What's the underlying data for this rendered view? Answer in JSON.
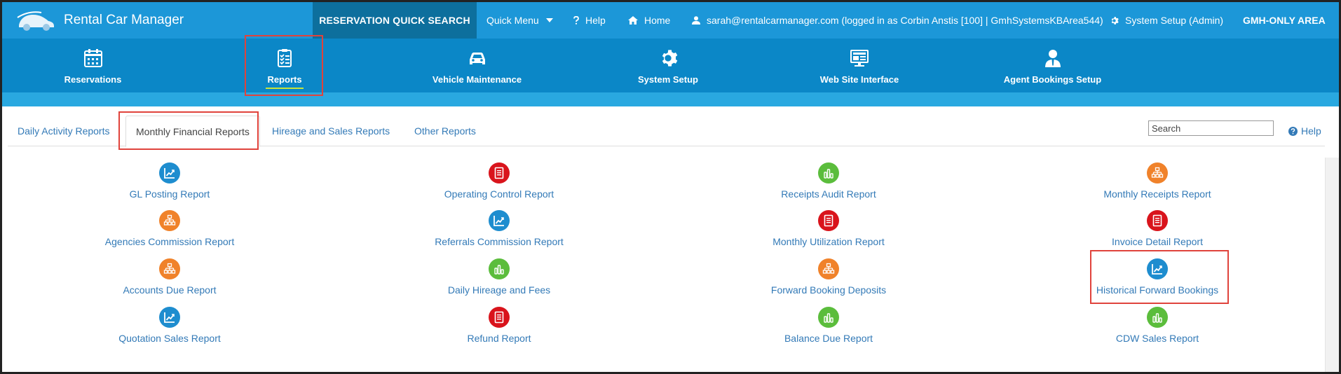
{
  "header": {
    "brand": "Rental Car Manager",
    "quick_search": "RESERVATION QUICK SEARCH",
    "quick_menu": "Quick Menu",
    "help": "Help",
    "home": "Home",
    "user": "sarah@rentalcarmanager.com (logged in as Corbin Anstis [100] | GmhSystemsKBArea544)",
    "system_setup": "System Setup (Admin)",
    "gmh_area": "GMH-ONLY AREA"
  },
  "main_nav": {
    "reservations": "Reservations",
    "reports": "Reports",
    "vehicle_maintenance": "Vehicle Maintenance",
    "system_setup": "System Setup",
    "web_site_interface": "Web Site Interface",
    "agent_bookings_setup": "Agent Bookings Setup",
    "active": "Reports"
  },
  "tabs": {
    "daily": "Daily Activity Reports",
    "monthly": "Monthly Financial Reports",
    "hireage": "Hireage and Sales Reports",
    "other": "Other Reports",
    "active": "Monthly Financial Reports"
  },
  "search": {
    "placeholder": "Search"
  },
  "help_link": "Help",
  "reports": [
    {
      "label": "GL Posting Report",
      "icon": "chart-icon",
      "color": "#1e8dcf"
    },
    {
      "label": "Operating Control Report",
      "icon": "document-icon",
      "color": "#d9141c"
    },
    {
      "label": "Receipts Audit Report",
      "icon": "bar-chart-icon",
      "color": "#5bbd3c"
    },
    {
      "label": "Monthly Receipts Report",
      "icon": "hierarchy-icon",
      "color": "#f0822a"
    },
    {
      "label": "Agencies Commission Report",
      "icon": "hierarchy-icon",
      "color": "#f0822a"
    },
    {
      "label": "Referrals Commission Report",
      "icon": "chart-icon",
      "color": "#1e8dcf"
    },
    {
      "label": "Monthly Utilization Report",
      "icon": "document-icon",
      "color": "#d9141c"
    },
    {
      "label": "Invoice Detail Report",
      "icon": "document-icon",
      "color": "#d9141c"
    },
    {
      "label": "Accounts Due Report",
      "icon": "hierarchy-icon",
      "color": "#f0822a"
    },
    {
      "label": "Daily Hireage and Fees",
      "icon": "bar-chart-icon",
      "color": "#5bbd3c"
    },
    {
      "label": "Forward Booking Deposits",
      "icon": "hierarchy-icon",
      "color": "#f0822a"
    },
    {
      "label": "Historical Forward Bookings",
      "icon": "chart-icon",
      "color": "#1e8dcf"
    },
    {
      "label": "Quotation Sales Report",
      "icon": "chart-icon",
      "color": "#1e8dcf"
    },
    {
      "label": "Refund Report",
      "icon": "document-icon",
      "color": "#d9141c"
    },
    {
      "label": "Balance Due Report",
      "icon": "bar-chart-icon",
      "color": "#5bbd3c"
    },
    {
      "label": "CDW Sales Report",
      "icon": "bar-chart-icon",
      "color": "#5bbd3c"
    }
  ],
  "highlight_color": "#e0433c"
}
